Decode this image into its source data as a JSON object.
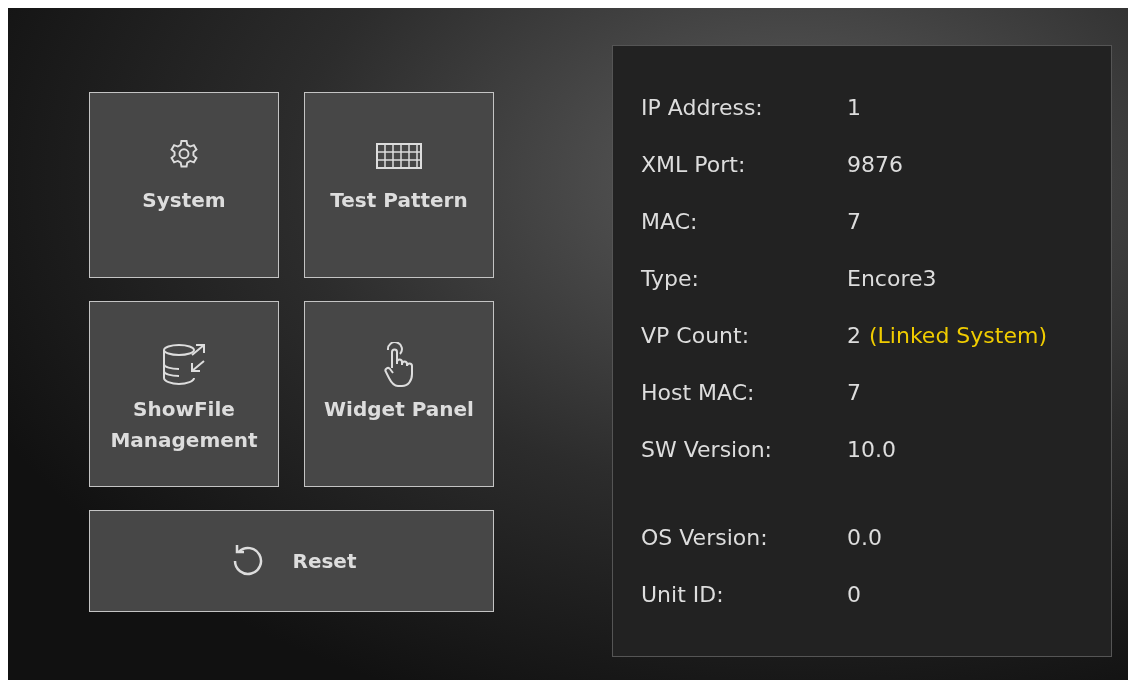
{
  "tiles": [
    {
      "label": "System"
    },
    {
      "label": "Test Pattern"
    },
    {
      "label": "ShowFile Management"
    },
    {
      "label": "Widget Panel"
    }
  ],
  "reset_button": {
    "label": "Reset"
  },
  "info_panel": {
    "sections": [
      [
        {
          "label": "IP Address:",
          "value": "1"
        },
        {
          "label": "XML Port:",
          "value": "9876"
        },
        {
          "label": "MAC:",
          "value": "7"
        },
        {
          "label": "Type:",
          "value": "Encore3"
        },
        {
          "label": "VP Count:",
          "value": "2",
          "note": "(Linked System)"
        },
        {
          "label": "Host MAC:",
          "value": "7"
        },
        {
          "label": "SW Version:",
          "value": "10.0"
        }
      ],
      [
        {
          "label": "OS Version:",
          "value": "0.0"
        },
        {
          "label": "Unit ID:",
          "value": "0"
        }
      ]
    ]
  }
}
